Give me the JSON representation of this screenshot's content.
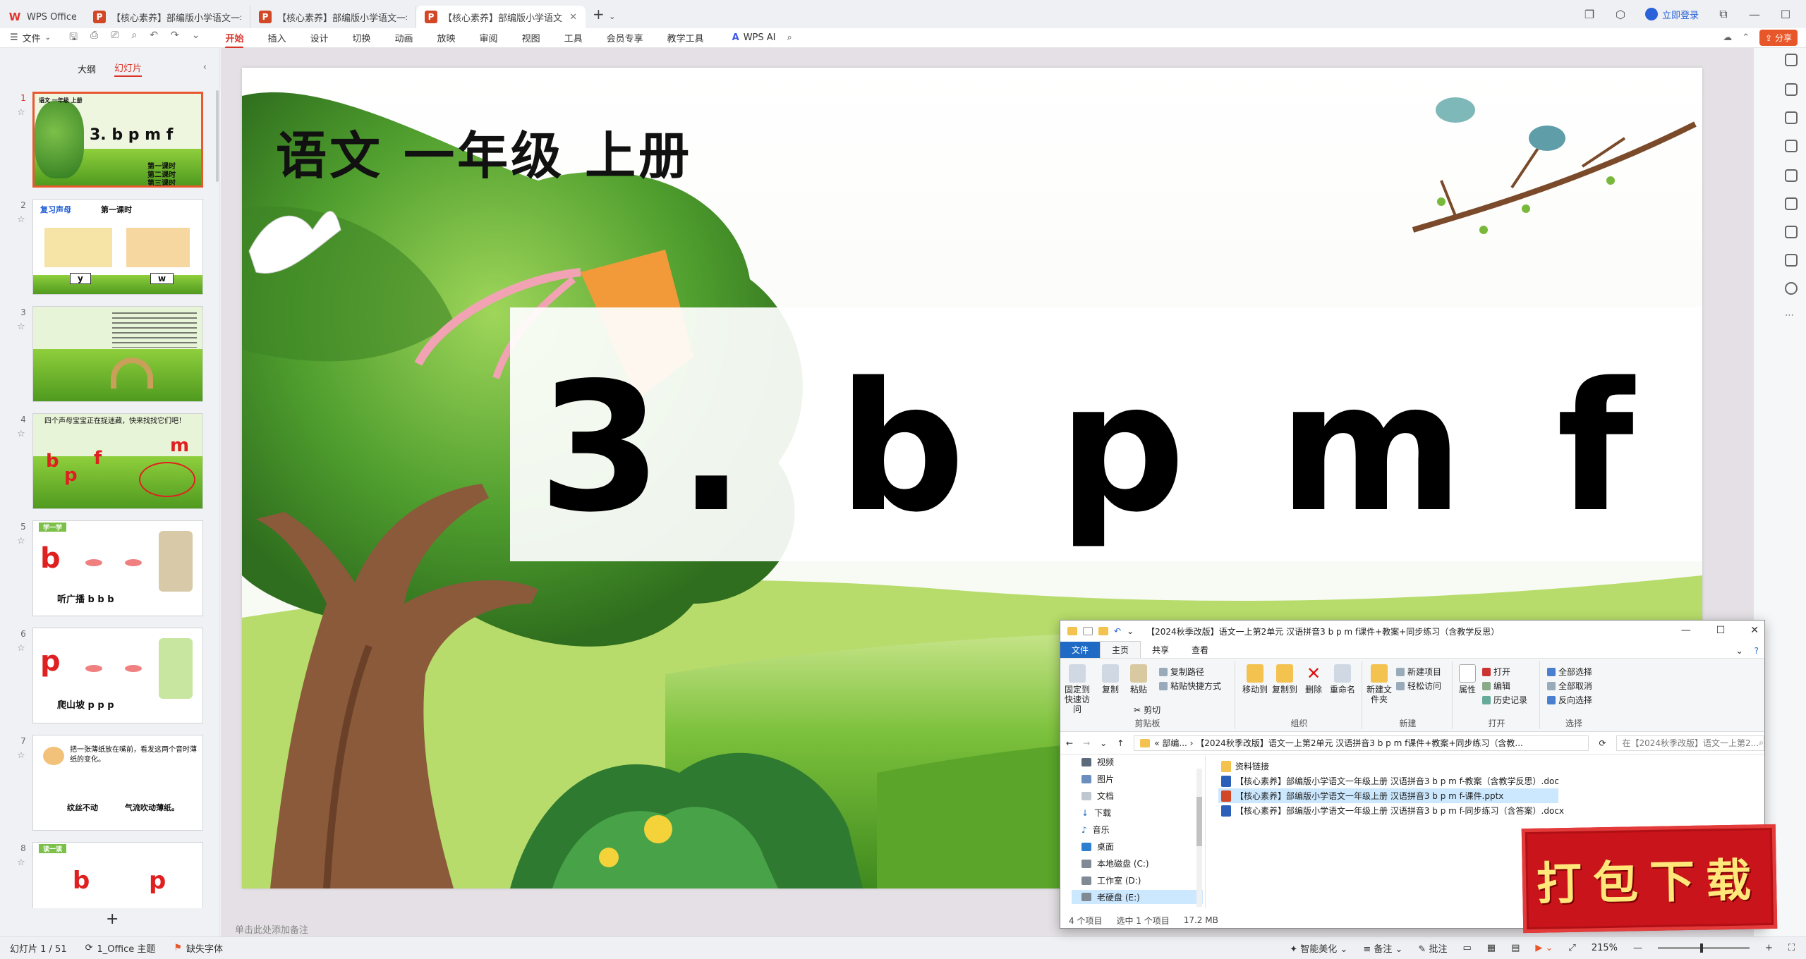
{
  "titlebar": {
    "wps_tab": "WPS Office",
    "tabs": [
      {
        "label": "【核心素养】部编版小学语文一年级"
      },
      {
        "label": "【核心素养】部编版小学语文一年级"
      },
      {
        "label": "【核心素养】部编版小学语文"
      }
    ],
    "login": "立即登录"
  },
  "menubar": {
    "file": "文件",
    "tabs": [
      "开始",
      "插入",
      "设计",
      "切换",
      "动画",
      "放映",
      "审阅",
      "视图",
      "工具",
      "会员专享",
      "教学工具"
    ],
    "ai": "WPS AI",
    "share": "分享"
  },
  "leftpanel": {
    "tab_outline": "大纲",
    "tab_slides": "幻灯片",
    "thumbs": [
      {
        "num": "1",
        "top_label": "语文 一年级 上册",
        "title": "3. b p m f",
        "lines": [
          "第一课时",
          "第二课时",
          "第三课时"
        ]
      },
      {
        "num": "2",
        "left": "复习声母",
        "right": "第一课时",
        "b1": "y",
        "b2": "w"
      },
      {
        "num": "3"
      },
      {
        "num": "4",
        "text": "四个声母宝宝正在捉迷藏，快来找找它们吧！",
        "letters": [
          "b",
          "p",
          "f",
          "m"
        ]
      },
      {
        "num": "5",
        "tag": "学一学",
        "letter": "b",
        "caption": "听广播 b b b"
      },
      {
        "num": "6",
        "letter": "p",
        "caption": "爬山坡 p p p"
      },
      {
        "num": "7",
        "text": "把一张薄纸放在嘴前，看发这两个音时薄纸的变化。",
        "c1": "纹丝不动",
        "c2": "气流吹动薄纸。"
      },
      {
        "num": "8",
        "tag": "读一读",
        "l1": "b",
        "l2": "p"
      }
    ]
  },
  "slide": {
    "title": "语文 一年级 上册",
    "main": "3. b p m f"
  },
  "notes_placeholder": "单击此处添加备注",
  "statusbar": {
    "slide_count": "幻灯片 1 / 51",
    "theme": "1_Office 主题",
    "missing_font": "缺失字体",
    "beautify": "智能美化",
    "notes": "备注",
    "comments": "批注",
    "zoom": "215%"
  },
  "explorer": {
    "title": "【2024秋季改版】语文一上第2单元 汉语拼音3 b p m f课件+教案+同步练习（含教学反思）",
    "tabs": [
      "文件",
      "主页",
      "共享",
      "查看"
    ],
    "ribbon": {
      "pin": "固定到快速访问",
      "copy": "复制",
      "paste": "粘贴",
      "copy_path": "复制路径",
      "paste_shortcut": "粘贴快捷方式",
      "cut": "剪切",
      "g_clipboard": "剪贴板",
      "move_to": "移动到",
      "copy_to": "复制到",
      "delete": "删除",
      "rename": "重命名",
      "g_organize": "组织",
      "new_folder": "新建文件夹",
      "new_item": "新建项目",
      "easy_access": "轻松访问",
      "g_new": "新建",
      "properties": "属性",
      "open": "打开",
      "edit": "编辑",
      "history": "历史记录",
      "g_open": "打开",
      "select_all": "全部选择",
      "select_none": "全部取消",
      "invert": "反向选择",
      "g_select": "选择"
    },
    "address": "« 部编... › 【2024秋季改版】语文一上第2单元 汉语拼音3 b p m f课件+教案+同步练习（含教...",
    "search": "在【2024秋季改版】语文一上第2...",
    "nav": [
      "视频",
      "图片",
      "文档",
      "下载",
      "音乐",
      "桌面",
      "本地磁盘 (C:)",
      "工作室 (D:)",
      "老硬盘 (E:)"
    ],
    "files": [
      {
        "name": "资料链接",
        "type": "folder"
      },
      {
        "name": "【核心素养】部编版小学语文一年级上册 汉语拼音3 b p m f-教案（含教学反思）.doc",
        "type": "doc"
      },
      {
        "name": "【核心素养】部编版小学语文一年级上册 汉语拼音3 b p m f-课件.pptx",
        "type": "ppt"
      },
      {
        "name": "【核心素养】部编版小学语文一年级上册 汉语拼音3 b p m f-同步练习（含答案）.docx",
        "type": "doc"
      }
    ],
    "status_items": "4 个项目",
    "status_selected": "选中 1 个项目",
    "status_size": "17.2 MB"
  },
  "badge": "打包下载",
  "colors": {
    "accent": "#d9362b",
    "wps_red": "#e0332e",
    "explorer_blue": "#1e6ac4",
    "badge_red": "#c8141a"
  }
}
